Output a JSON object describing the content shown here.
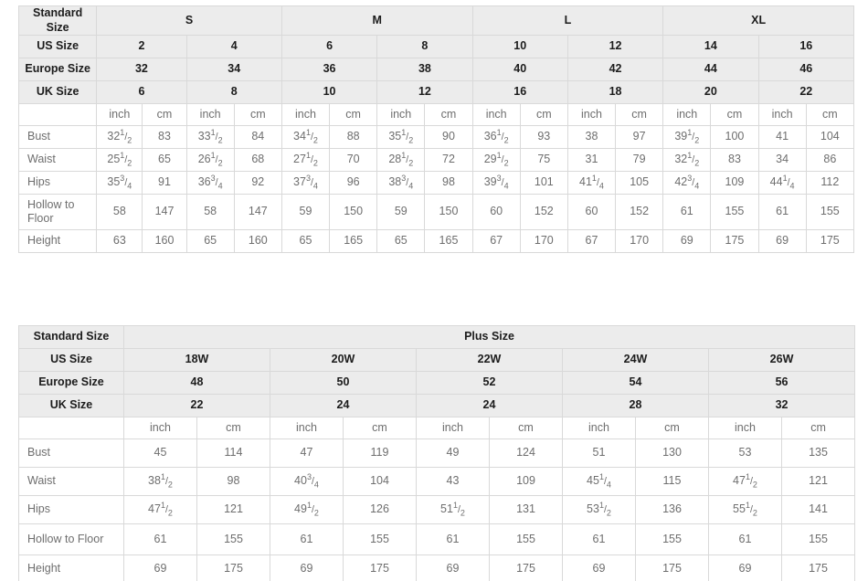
{
  "standard_table": {
    "corner_label": "Standard\nSize",
    "corner_label_line1": "Standard",
    "corner_label_line2": "Size",
    "size_groups": [
      "S",
      "M",
      "L",
      "XL"
    ],
    "row_headers": [
      "US Size",
      "Europe Size",
      "UK Size"
    ],
    "us_sizes": [
      "2",
      "4",
      "6",
      "8",
      "10",
      "12",
      "14",
      "16"
    ],
    "europe_sizes": [
      "32",
      "34",
      "36",
      "38",
      "40",
      "42",
      "44",
      "46"
    ],
    "uk_sizes": [
      "6",
      "8",
      "10",
      "12",
      "16",
      "18",
      "20",
      "22"
    ],
    "unit_inch": "inch",
    "unit_cm": "cm",
    "measurements": [
      {
        "label": "Bust",
        "inch": [
          "32 1/2",
          "33 1/2",
          "34 1/2",
          "35 1/2",
          "36 1/2",
          "38",
          "39 1/2",
          "41"
        ],
        "cm": [
          "83",
          "84",
          "88",
          "90",
          "93",
          "97",
          "100",
          "104"
        ]
      },
      {
        "label": "Waist",
        "inch": [
          "25 1/2",
          "26 1/2",
          "27 1/2",
          "28 1/2",
          "29 1/2",
          "31",
          "32 1/2",
          "34"
        ],
        "cm": [
          "65",
          "68",
          "70",
          "72",
          "75",
          "79",
          "83",
          "86"
        ]
      },
      {
        "label": "Hips",
        "inch": [
          "35 3/4",
          "36 3/4",
          "37 3/4",
          "38 3/4",
          "39 3/4",
          "41 1/4",
          "42 3/4",
          "44 1/4"
        ],
        "cm": [
          "91",
          "92",
          "96",
          "98",
          "101",
          "105",
          "109",
          "112"
        ]
      },
      {
        "label": "Hollow to Floor",
        "label_line1": "Hollow to",
        "label_line2": "Floor",
        "inch": [
          "58",
          "58",
          "59",
          "59",
          "60",
          "60",
          "61",
          "61"
        ],
        "cm": [
          "147",
          "147",
          "150",
          "150",
          "152",
          "152",
          "155",
          "155"
        ]
      },
      {
        "label": "Height",
        "inch": [
          "63",
          "65",
          "65",
          "65",
          "67",
          "67",
          "69",
          "69"
        ],
        "cm": [
          "160",
          "160",
          "165",
          "165",
          "170",
          "170",
          "175",
          "175"
        ]
      }
    ]
  },
  "plus_table": {
    "corner_label": "Standard Size",
    "group_title": "Plus Size",
    "row_headers": [
      "US Size",
      "Europe Size",
      "UK Size"
    ],
    "us_sizes": [
      "18W",
      "20W",
      "22W",
      "24W",
      "26W"
    ],
    "europe_sizes": [
      "48",
      "50",
      "52",
      "54",
      "56"
    ],
    "uk_sizes": [
      "22",
      "24",
      "24",
      "28",
      "32"
    ],
    "unit_inch": "inch",
    "unit_cm": "cm",
    "measurements": [
      {
        "label": "Bust",
        "inch": [
          "45",
          "47",
          "49",
          "51",
          "53"
        ],
        "cm": [
          "114",
          "119",
          "124",
          "130",
          "135"
        ]
      },
      {
        "label": "Waist",
        "inch": [
          "38 1/2",
          "40 3/4",
          "43",
          "45 1/4",
          "47 1/2"
        ],
        "cm": [
          "98",
          "104",
          "109",
          "115",
          "121"
        ]
      },
      {
        "label": "Hips",
        "inch": [
          "47 1/2",
          "49 1/2",
          "51 1/2",
          "53 1/2",
          "55 1/2"
        ],
        "cm": [
          "121",
          "126",
          "131",
          "136",
          "141"
        ]
      },
      {
        "label": "Hollow to Floor",
        "inch": [
          "61",
          "61",
          "61",
          "61",
          "61"
        ],
        "cm": [
          "155",
          "155",
          "155",
          "155",
          "155"
        ]
      },
      {
        "label": "Height",
        "inch": [
          "69",
          "69",
          "69",
          "69",
          "69"
        ],
        "cm": [
          "175",
          "175",
          "175",
          "175",
          "175"
        ]
      }
    ]
  },
  "colors": {
    "header_bg": "#ececec",
    "border": "#d9d9d9",
    "header_text": "#1c1c1c",
    "data_text": "#6e6e6e",
    "body_bg": "#ffffff"
  }
}
